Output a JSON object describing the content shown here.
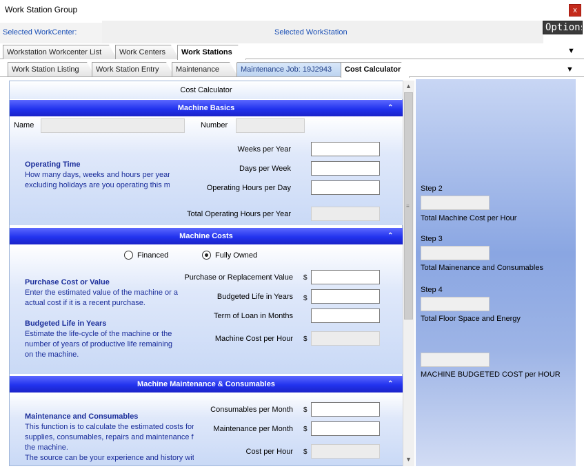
{
  "window": {
    "title": "Work Station Group",
    "close_label": "x"
  },
  "selection": {
    "workcenter_label": "Selected WorkCenter:",
    "workstation_label": "Selected WorkStation",
    "options_label": "Options"
  },
  "tabs_level1": [
    {
      "label": "Workstation Workcenter List",
      "active": false
    },
    {
      "label": "Work Centers",
      "active": false
    },
    {
      "label": "Work Stations",
      "active": true
    }
  ],
  "tabs_level2": [
    {
      "label": "Work Station Listing",
      "active": false
    },
    {
      "label": "Work Station Entry",
      "active": false
    },
    {
      "label": "Maintenance",
      "active": false
    },
    {
      "label": "Maintenance Job: 19J2943",
      "active": false
    },
    {
      "label": "Cost Calculator",
      "active": true
    }
  ],
  "calculator": {
    "title": "Cost Calculator",
    "machine_basics": {
      "header": "Machine Basics",
      "name_label": "Name",
      "name_value": "",
      "number_label": "Number",
      "number_value": "",
      "operating_time_heading": "Operating Time",
      "operating_time_line1": "How many days, weeks and hours per year",
      "operating_time_line2": "excluding holidays are you operating this ma",
      "weeks_label": "Weeks per Year",
      "weeks_value": "",
      "days_label": "Days per Week",
      "days_value": "",
      "hours_label": "Operating Hours per Day",
      "hours_value": "",
      "total_label": "Total Operating Hours per Year",
      "total_value": ""
    },
    "machine_costs": {
      "header": "Machine Costs",
      "radio_financed": "Financed",
      "radio_owned": "Fully Owned",
      "selected": "Fully Owned",
      "purchase_heading": "Purchase Cost or Value",
      "purchase_line1": "Enter the estimated value of the machine or an",
      "purchase_line2": "actual cost if it is a recent purchase.",
      "life_heading": "Budgeted Life in Years",
      "life_line1": "Estimate the life-cycle of the machine or the",
      "life_line2": "number of years of productive life remaining",
      "life_line3": "on the machine.",
      "purchase_label": "Purchase or Replacement Value",
      "purchase_value": "",
      "life_label": "Budgeted Life in Years",
      "life_value": "",
      "loan_label": "Term of Loan in Months",
      "loan_value": "",
      "cost_hour_label": "Machine Cost per Hour",
      "cost_hour_value": "",
      "currency": "$"
    },
    "maintenance": {
      "header": "Machine Maintenance & Consumables",
      "heading": "Maintenance and Consumables",
      "line1": "This function is to calculate the estimated costs for",
      "line2": "supplies, consumables, repairs and maintenance for",
      "line3": "the machine.",
      "line4": "The source can be your experience and history with",
      "consumables_label": "Consumables per Month",
      "consumables_value": "",
      "maint_label": "Maintenance per Month",
      "maint_value": "",
      "cost_hour_label": "Cost per Hour",
      "cost_hour_value": "",
      "currency": "$"
    }
  },
  "summary": {
    "step2_label": "Step 2",
    "step2_caption": "Total Machine Cost per Hour",
    "step3_label": "Step 3",
    "step3_caption": "Total Mainenance and Consumables",
    "step4_label": "Step 4",
    "step4_caption": "Total Floor Space and Energy",
    "budget_caption": "MACHINE BUDGETED COST per HOUR"
  }
}
